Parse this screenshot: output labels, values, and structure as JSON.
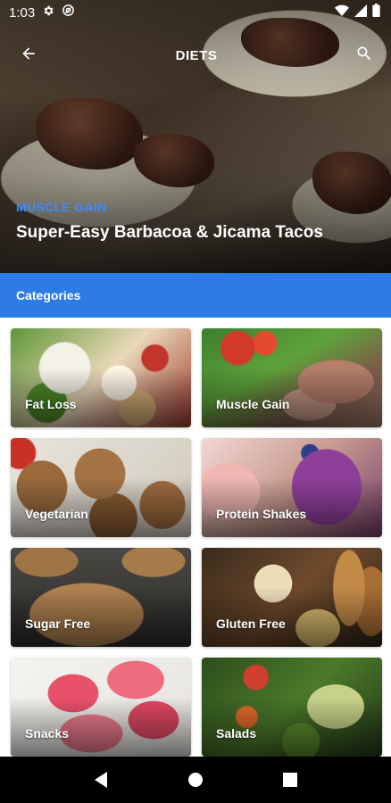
{
  "status_bar": {
    "time": "1:03",
    "icons": [
      "gear-icon",
      "at-sign-icon",
      "wifi-icon",
      "signal-icon",
      "battery-icon"
    ]
  },
  "toolbar": {
    "title": "DIETS",
    "back_icon": "arrow-back-icon",
    "search_icon": "search-icon"
  },
  "hero": {
    "category": "MUSCLE GAIN",
    "title": "Super-Easy Barbacoa & Jicama Tacos"
  },
  "categories": {
    "header": "Categories",
    "items": [
      {
        "label": "Fat Loss"
      },
      {
        "label": "Muscle Gain"
      },
      {
        "label": "Vegetarian"
      },
      {
        "label": "Protein Shakes"
      },
      {
        "label": "Sugar Free"
      },
      {
        "label": "Gluten Free"
      },
      {
        "label": "Snacks"
      },
      {
        "label": "Salads"
      }
    ]
  },
  "nav_bar": {
    "buttons": [
      "back-triangle-icon",
      "home-circle-icon",
      "recents-square-icon"
    ]
  },
  "colors": {
    "accent": "#2f7be6",
    "hero_category": "#3d8bff"
  }
}
